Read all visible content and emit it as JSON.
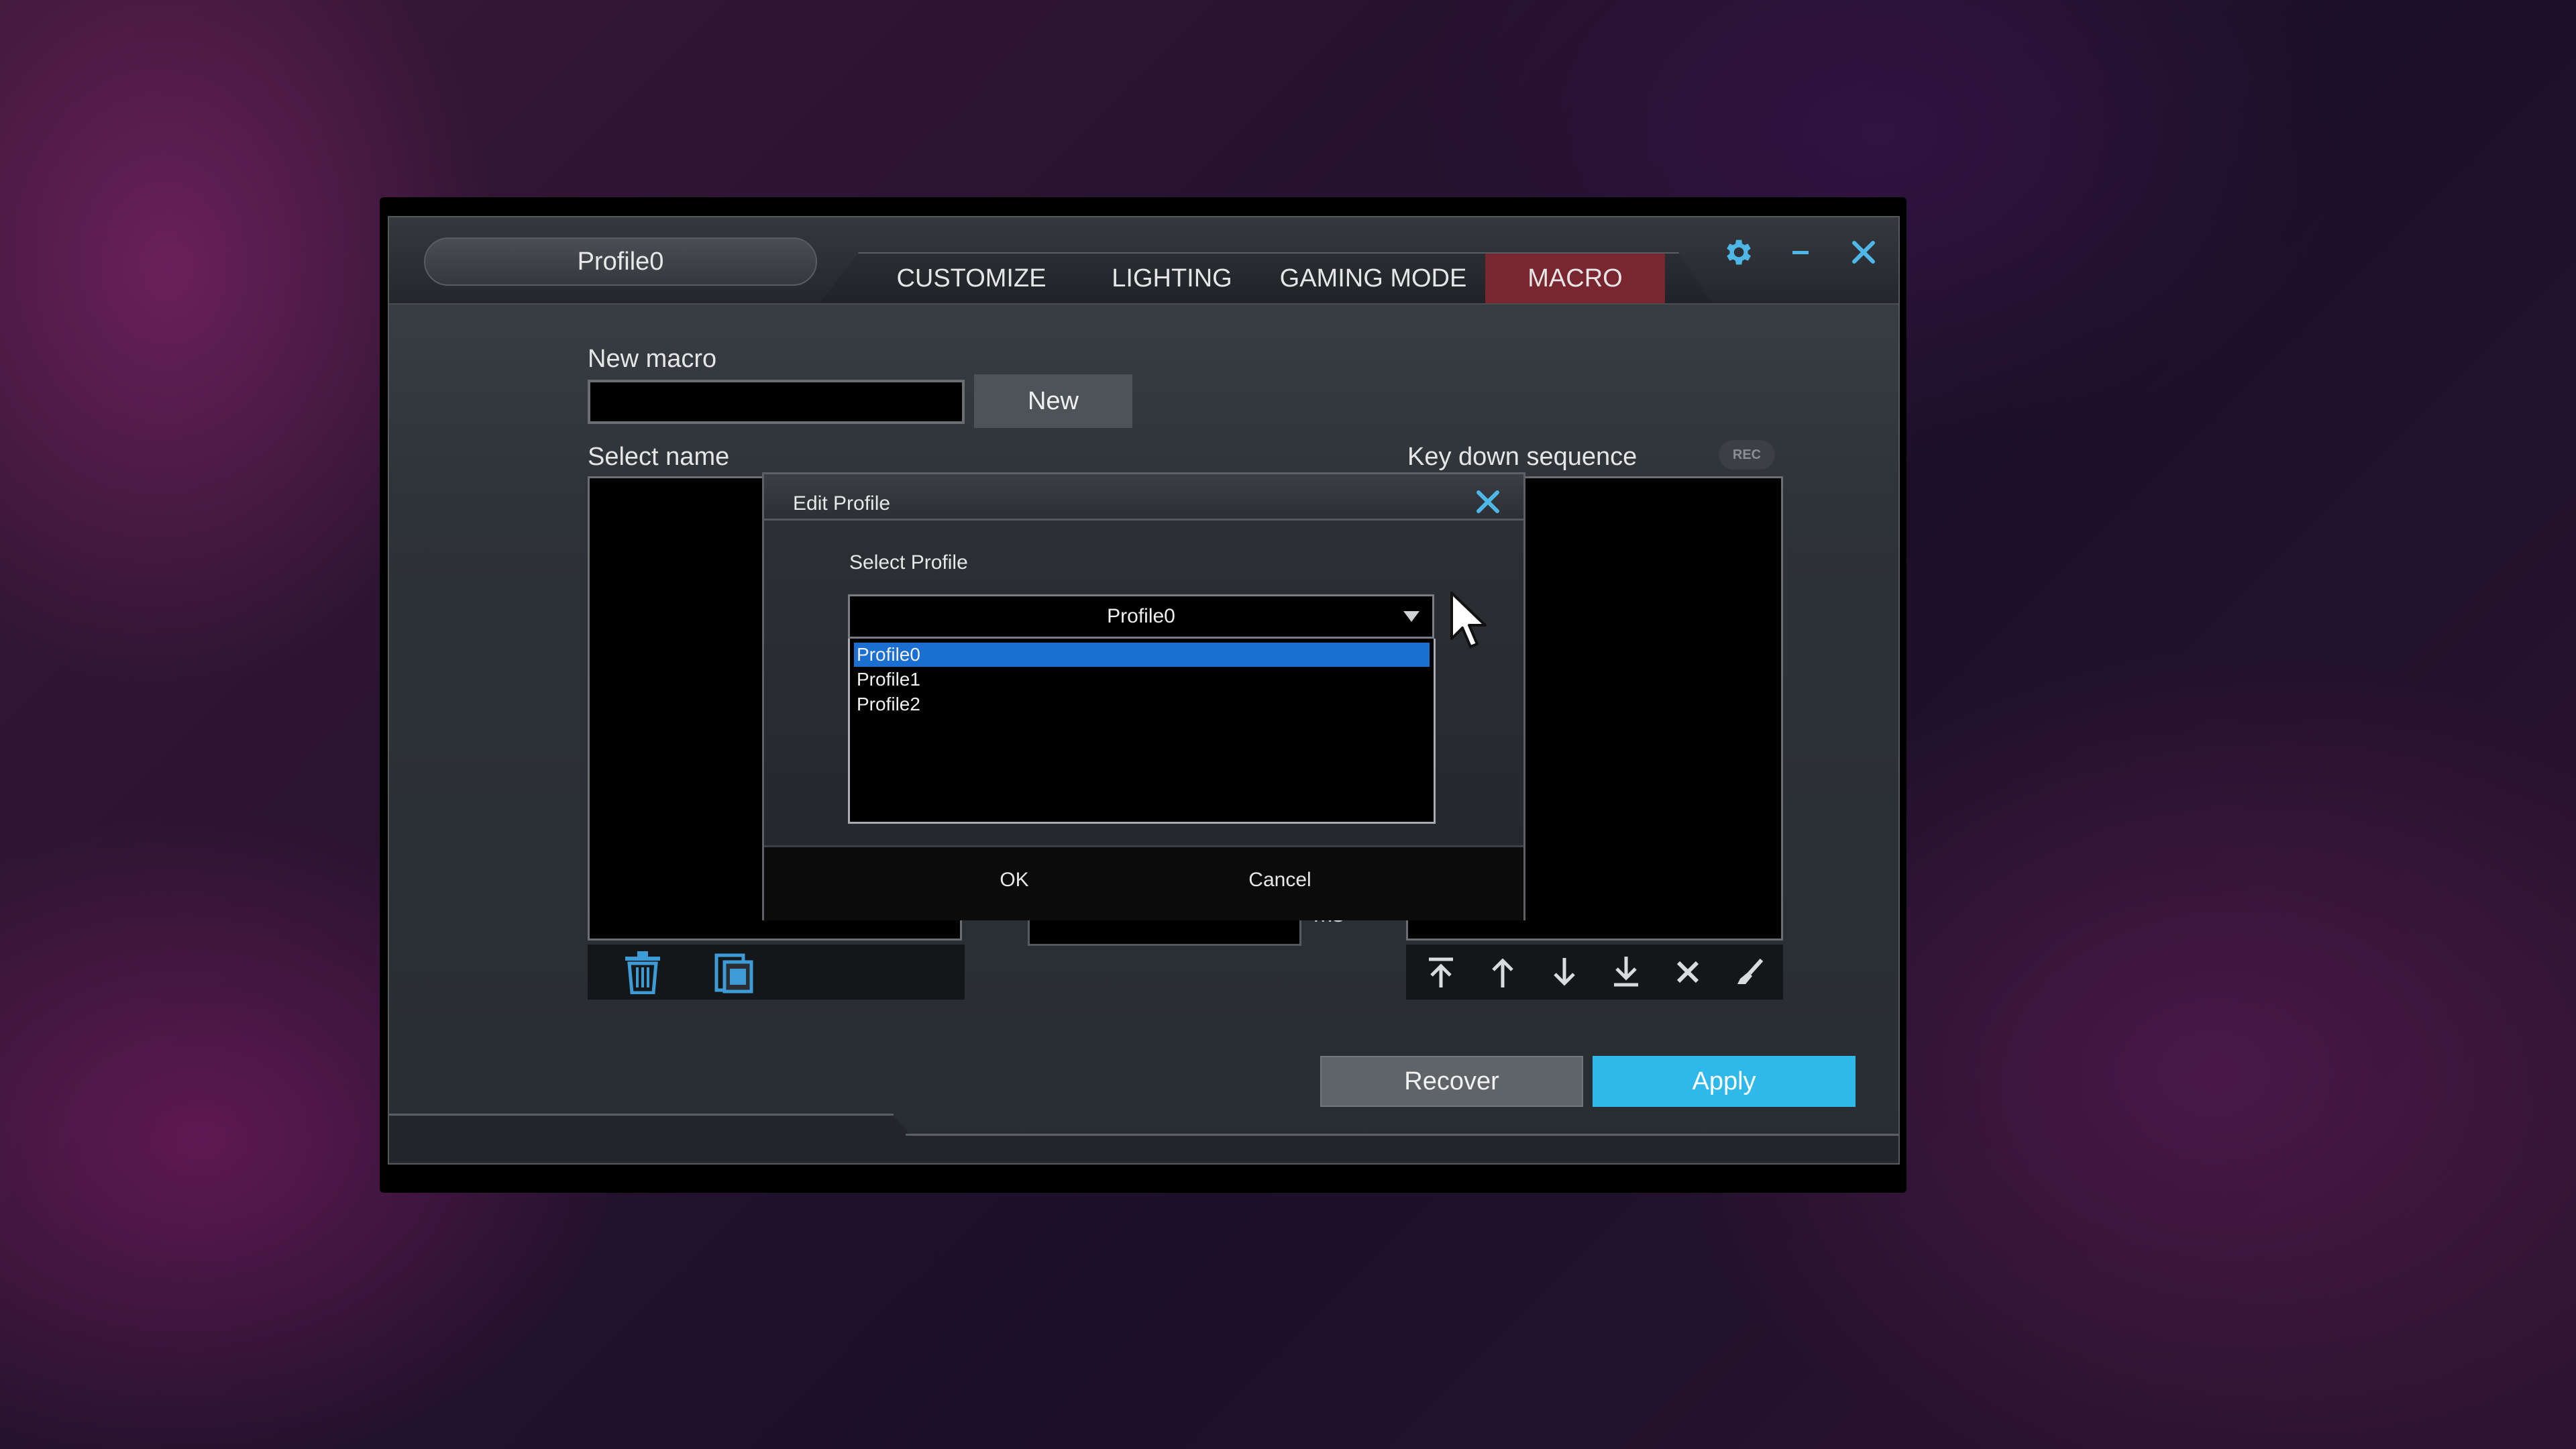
{
  "window": {
    "profile_name": "Profile0",
    "tabs": [
      {
        "label": "CUSTOMIZE"
      },
      {
        "label": "LIGHTING"
      },
      {
        "label": "GAMING MODE"
      },
      {
        "label": "MACRO"
      }
    ],
    "active_tab": "MACRO",
    "icons": {
      "settings": "gear-icon",
      "minimize": "minimize-icon",
      "close": "close-icon"
    }
  },
  "macro": {
    "new_macro_label": "New macro",
    "new_macro_value": "",
    "new_button": "New",
    "select_name_label": "Select name",
    "key_down_label": "Key down sequence",
    "rec_badge": "REC",
    "delay_value": "",
    "delay_unit": "ms",
    "recover_button": "Recover",
    "apply_button": "Apply"
  },
  "dialog": {
    "title": "Edit Profile",
    "select_label": "Select Profile",
    "dropdown_value": "Profile0",
    "options": [
      "Profile0",
      "Profile1",
      "Profile2"
    ],
    "selected_index": 0,
    "ok_button": "OK",
    "cancel_button": "Cancel"
  },
  "colors": {
    "accent_blue": "#2fb9ea",
    "active_tab": "#7a2630",
    "selection": "#1a6fd1"
  }
}
